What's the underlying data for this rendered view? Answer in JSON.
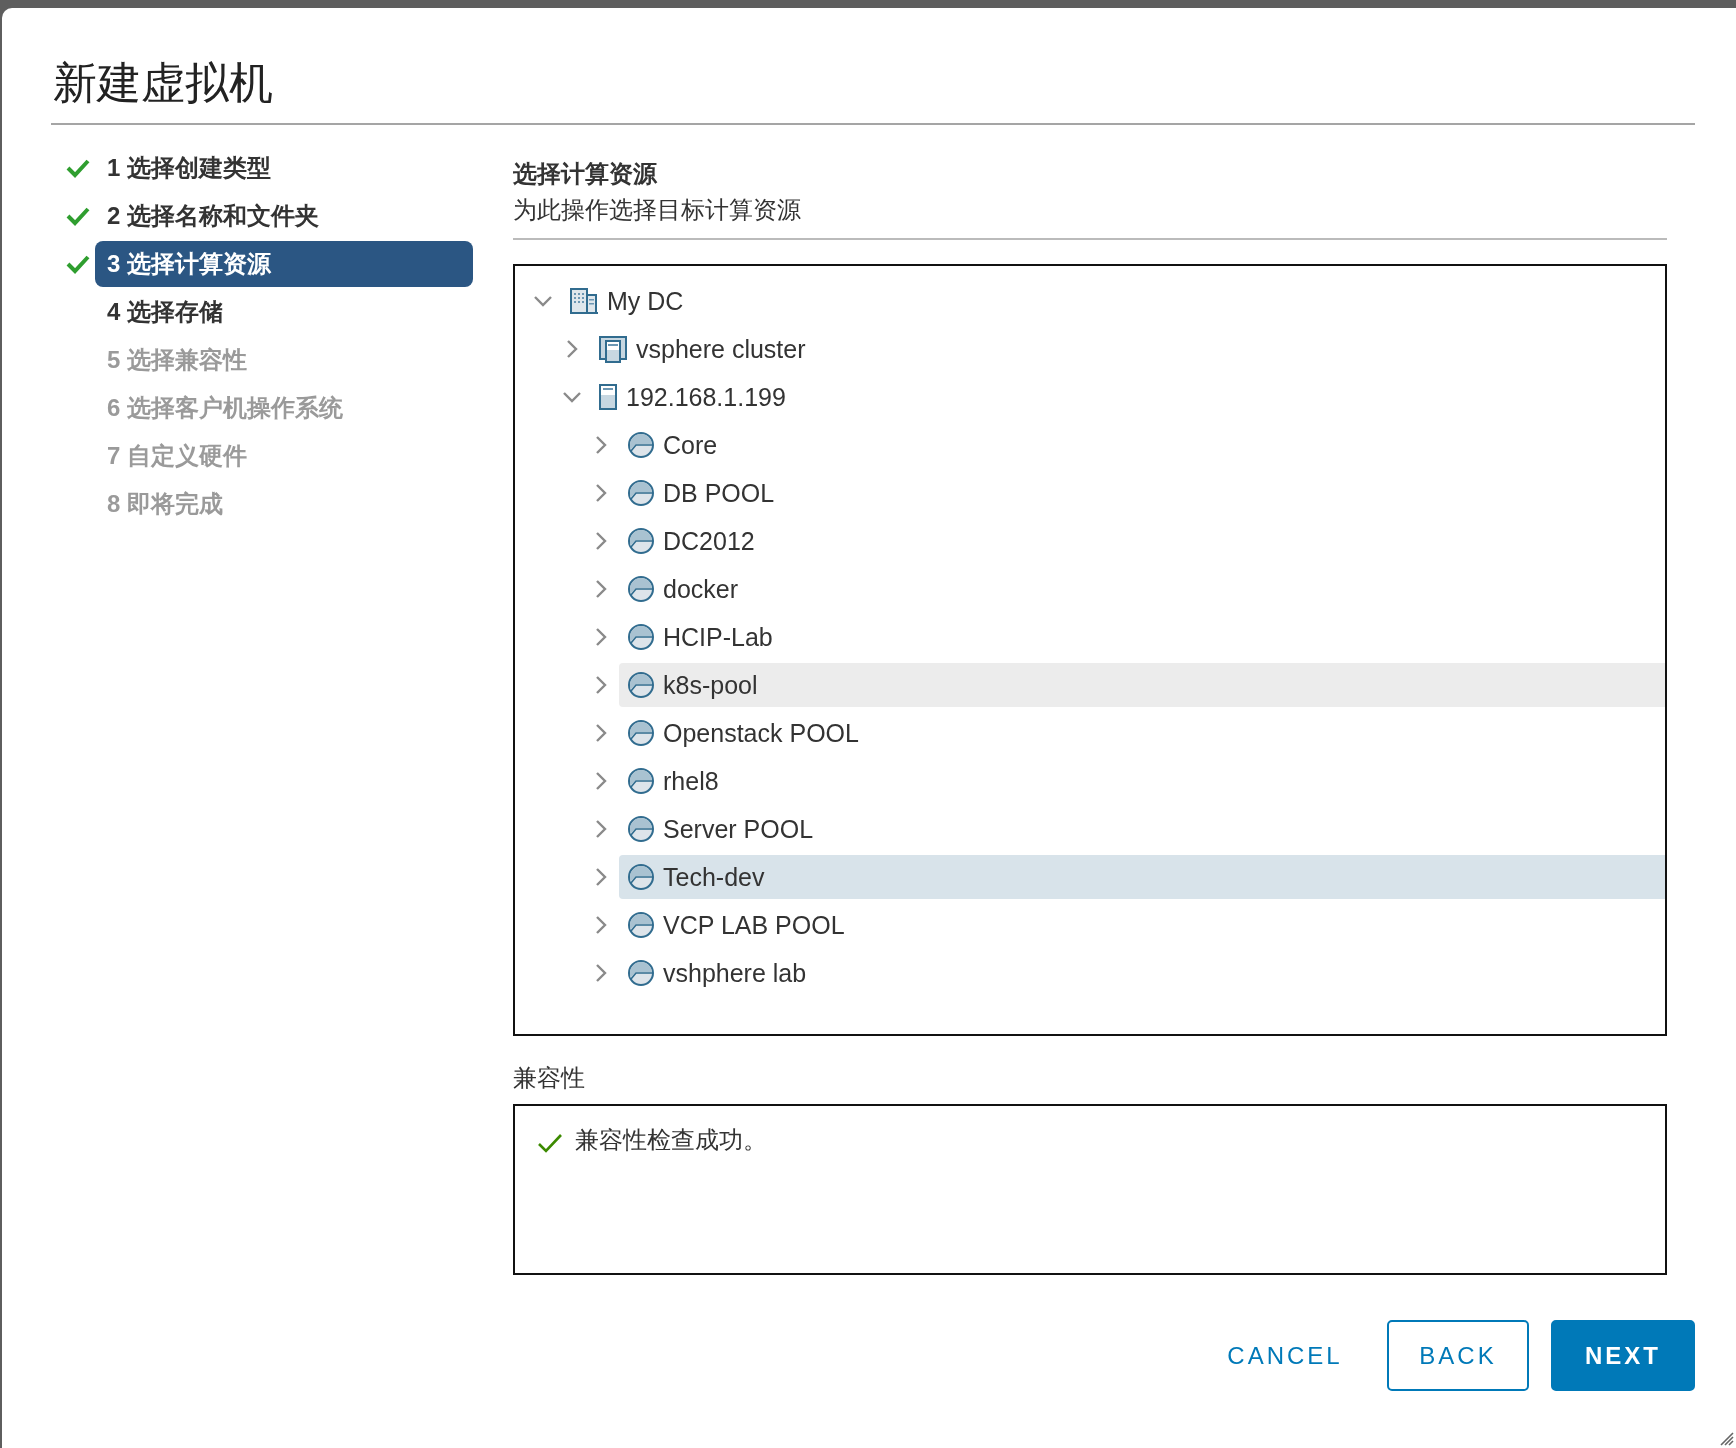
{
  "window": {
    "title": "新建虚拟机"
  },
  "steps": [
    {
      "label": "1 选择创建类型",
      "completed": true,
      "selected": false,
      "disabled": false
    },
    {
      "label": "2 选择名称和文件夹",
      "completed": true,
      "selected": false,
      "disabled": false
    },
    {
      "label": "3 选择计算资源",
      "completed": true,
      "selected": true,
      "disabled": false
    },
    {
      "label": "4 选择存储",
      "completed": false,
      "selected": false,
      "disabled": false
    },
    {
      "label": "5 选择兼容性",
      "completed": false,
      "selected": false,
      "disabled": true
    },
    {
      "label": "6 选择客户机操作系统",
      "completed": false,
      "selected": false,
      "disabled": true
    },
    {
      "label": "7 自定义硬件",
      "completed": false,
      "selected": false,
      "disabled": true
    },
    {
      "label": "8 即将完成",
      "completed": false,
      "selected": false,
      "disabled": true
    }
  ],
  "page": {
    "title": "选择计算资源",
    "subtitle": "为此操作选择目标计算资源"
  },
  "tree": [
    {
      "kind": "datacenter",
      "label": "My DC",
      "expanded": true,
      "selected": false,
      "hovered": false,
      "children": [
        {
          "kind": "cluster",
          "label": "vsphere cluster",
          "expanded": false,
          "selected": false,
          "hovered": false
        },
        {
          "kind": "host",
          "label": "192.168.1.199",
          "expanded": true,
          "selected": false,
          "hovered": false,
          "children": [
            {
              "kind": "pool",
              "label": "Core",
              "expanded": false,
              "selected": false,
              "hovered": false
            },
            {
              "kind": "pool",
              "label": "DB POOL",
              "expanded": false,
              "selected": false,
              "hovered": false
            },
            {
              "kind": "pool",
              "label": "DC2012",
              "expanded": false,
              "selected": false,
              "hovered": false
            },
            {
              "kind": "pool",
              "label": "docker",
              "expanded": false,
              "selected": false,
              "hovered": false
            },
            {
              "kind": "pool",
              "label": "HCIP-Lab",
              "expanded": false,
              "selected": false,
              "hovered": false
            },
            {
              "kind": "pool",
              "label": "k8s-pool",
              "expanded": false,
              "selected": false,
              "hovered": true
            },
            {
              "kind": "pool",
              "label": "Openstack POOL",
              "expanded": false,
              "selected": false,
              "hovered": false
            },
            {
              "kind": "pool",
              "label": "rhel8",
              "expanded": false,
              "selected": false,
              "hovered": false
            },
            {
              "kind": "pool",
              "label": "Server POOL",
              "expanded": false,
              "selected": false,
              "hovered": false
            },
            {
              "kind": "pool",
              "label": "Tech-dev",
              "expanded": false,
              "selected": true,
              "hovered": false
            },
            {
              "kind": "pool",
              "label": "VCP LAB POOL",
              "expanded": false,
              "selected": false,
              "hovered": false
            },
            {
              "kind": "pool",
              "label": "vshphere lab",
              "expanded": false,
              "selected": false,
              "hovered": false
            }
          ]
        }
      ]
    }
  ],
  "compatibility": {
    "label": "兼容性",
    "passed": true,
    "message": "兼容性检查成功。"
  },
  "buttons": [
    {
      "kind": "link",
      "label": "CANCEL"
    },
    {
      "kind": "outline",
      "label": "BACK"
    },
    {
      "kind": "primary",
      "label": "NEXT"
    }
  ]
}
